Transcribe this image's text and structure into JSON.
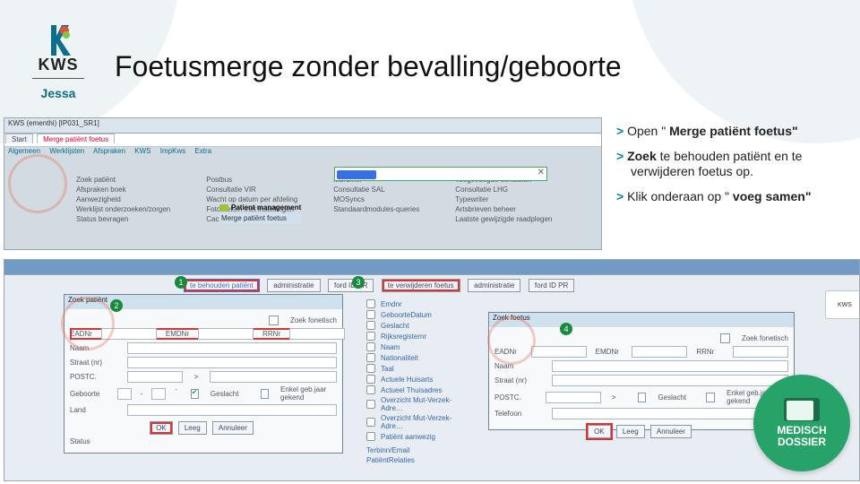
{
  "brand": {
    "name": "KWS",
    "org": "Jessa"
  },
  "title": "Foetusmerge zonder bevalling/geboorte",
  "instructions": [
    {
      "pre": "Open \"",
      "bold": "Merge patiënt foetus\""
    },
    {
      "bold": "Zoek",
      "post": " te behouden patiënt en te verwijderen foetus op."
    },
    {
      "pre": "Klik onderaan op \"",
      "bold": "voeg samen\""
    }
  ],
  "shot1": {
    "winTitle": "KWS (ementhi) [IP031_SR1]",
    "tabs": [
      "Start",
      "Merge patiënt foetus"
    ],
    "menus": [
      "Algemeen",
      "Werklijsten",
      "Afspraken",
      "KWS",
      "ImpKws",
      "Extra"
    ],
    "cols": [
      [
        "Zoek patiënt",
        "Afspraken boek",
        "Aanwezigheid",
        "Werklijst onderzoeken/zorgen",
        "Status bevragen"
      ],
      [
        "Postbus",
        "Consultatie VIR",
        "Wacht op datum per afdeling",
        "Fototheken met instellingen",
        "Cache legen HL hen"
      ],
      [
        "Murumer",
        "Consultatie SAL",
        "MOSyncs",
        "Standaardmodules-queries"
      ],
      [
        "Toegevoegde contacten",
        "Consultatie LHG",
        "Typewriter",
        "Artsbrieven beheer",
        "Laatste gewijzigde raadplegen"
      ]
    ],
    "pmHeader": "Patient management",
    "pmItem": "Merge patiënt foetus"
  },
  "shot2": {
    "winTitle": "",
    "badges": [
      "1",
      "2",
      "3",
      "4"
    ],
    "tabsTop": [
      "te behouden patiënt",
      "administratie",
      "ford ID PR",
      "te verwijderen foetus",
      "administratie",
      "ford ID PR"
    ],
    "dlg1": {
      "title": "Zoek patiënt",
      "fonetisch": "Zoek fonetisch",
      "labels": [
        "EADNr",
        "EMDNr",
        "RRNr",
        "Naam",
        "Straat (nr)",
        "POSTC.",
        "Geboorte",
        "Land",
        "Status"
      ],
      "geslacht": "Geslacht",
      "jaarGekend": "Enkel geb.jaar gekend",
      "buttons": [
        "OK",
        "Leeg",
        "Annuleer"
      ]
    },
    "midList": [
      "Emdnr",
      "GeboorteDatum",
      "Geslacht",
      "Rijksregisternr",
      "Naam",
      "Nationaliteit",
      "Taal",
      "Actuele Huisarts",
      "Actueel Thuisadres",
      "Overzicht Mut-Verzek-Adre…",
      "Overzicht Mut-Verzek-Adre…",
      "Patiënt aanwezig"
    ],
    "midLinks": [
      "Terbinn/Email",
      "PatiëntRelaties"
    ],
    "dlg2": {
      "title": "Zoek foetus",
      "telefoon": "Telefoon"
    }
  },
  "medallion": {
    "line1": "MEDISCH",
    "line2": "DOSSIER"
  }
}
